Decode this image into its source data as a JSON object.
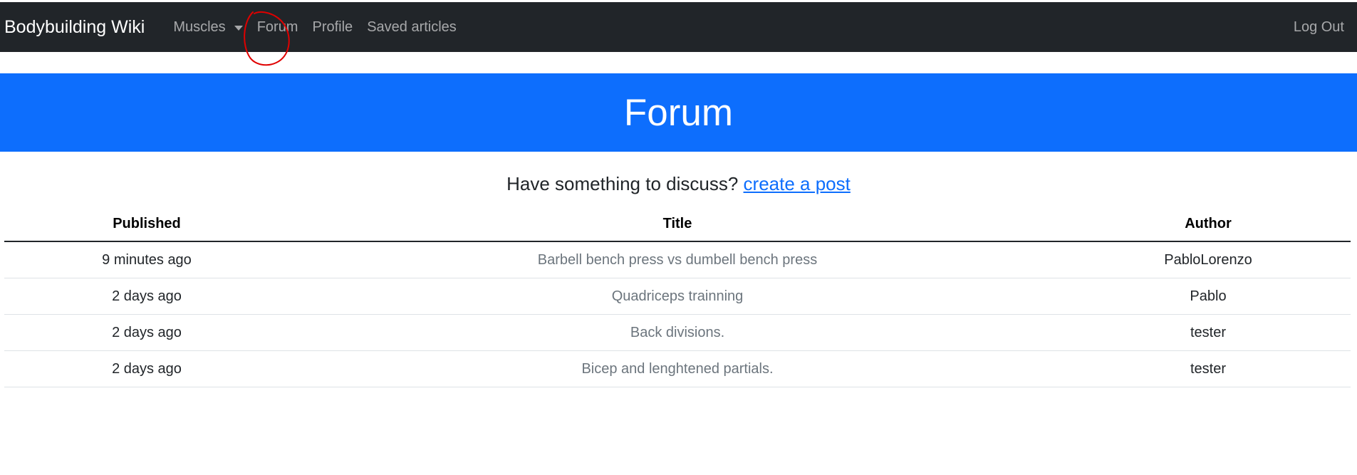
{
  "navbar": {
    "brand": "Bodybuilding Wiki",
    "links": [
      {
        "label": "Muscles",
        "dropdown": true
      },
      {
        "label": "Forum"
      },
      {
        "label": "Profile"
      },
      {
        "label": "Saved articles"
      }
    ],
    "logout": "Log Out"
  },
  "hero": {
    "title": "Forum"
  },
  "cta": {
    "text": "Have something to discuss? ",
    "link": "create a post"
  },
  "table": {
    "headers": [
      "Published",
      "Title",
      "Author"
    ],
    "rows": [
      {
        "published": "9 minutes ago",
        "title": "Barbell bench press vs dumbell bench press",
        "author": "PabloLorenzo"
      },
      {
        "published": "2 days ago",
        "title": "Quadriceps trainning",
        "author": "Pablo"
      },
      {
        "published": "2 days ago",
        "title": "Back divisions.",
        "author": "tester"
      },
      {
        "published": "2 days ago",
        "title": "Bicep and lenghtened partials.",
        "author": "tester"
      }
    ]
  },
  "colors": {
    "navbar_bg": "#212529",
    "hero_bg": "#0d6efd",
    "link": "#0d6efd",
    "annotation": "#e00000"
  }
}
